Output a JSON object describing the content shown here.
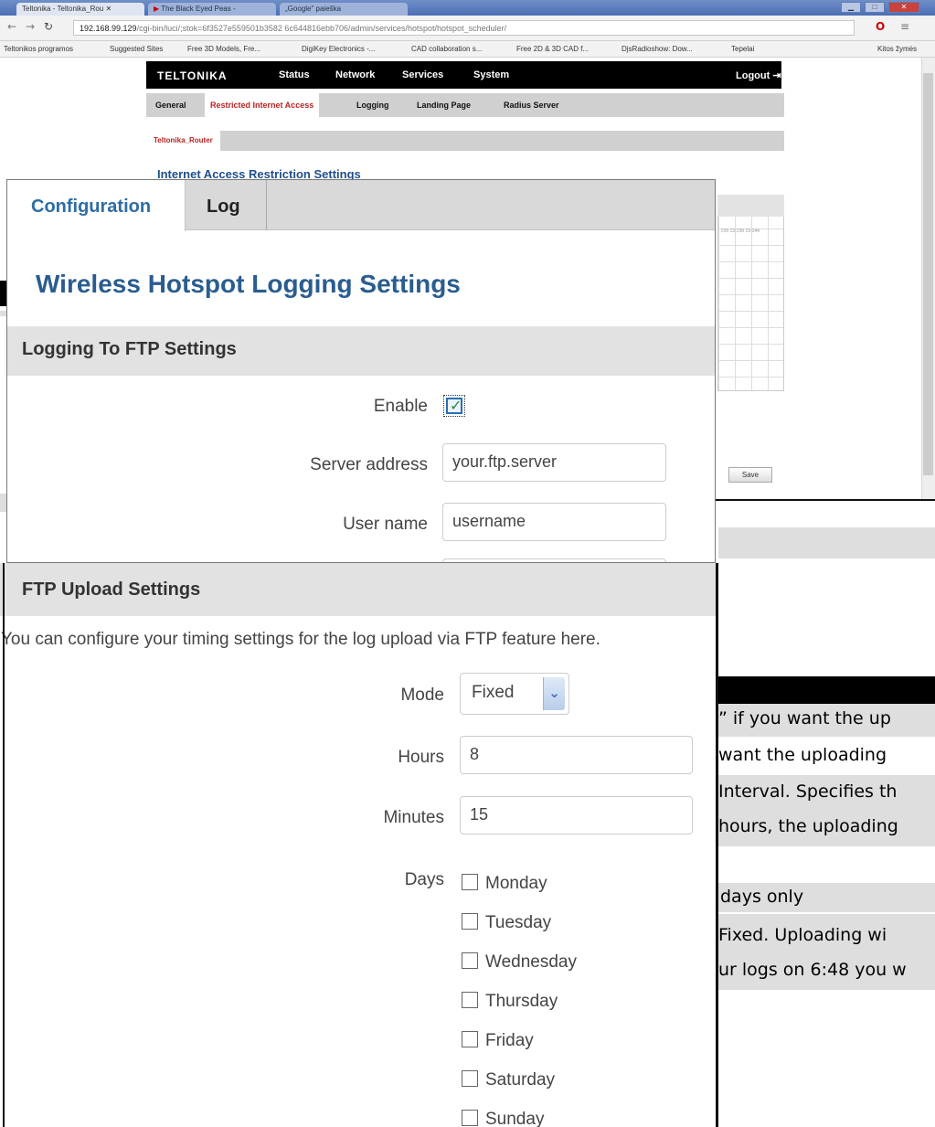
{
  "browser": {
    "tabs": [
      "Teltonika - Teltonika_Rou",
      "The Black Eyed Peas -",
      "„Google\" paieška"
    ],
    "url_host": "192.168.99.129",
    "url_path": "/cgi-bin/luci/;stok=6f3527e559501b3582 6c644816ebb706/admin/services/hotspot/hotspot_scheduler/",
    "bookmarks": [
      "Teltonikos programos",
      "Suggested Sites",
      "Free 3D Models, Fre...",
      "DigiKey Electronics -...",
      "CAD collaboration s...",
      "Free 2D & 3D CAD f...",
      "DjsRadioshow: Dow...",
      "Tepelai",
      "Kitos žymės"
    ]
  },
  "teltonika": {
    "logo": "TELTONIKA",
    "nav": [
      "Status",
      "Network",
      "Services",
      "System"
    ],
    "logout": "Logout",
    "tabs": [
      "General",
      "Restricted Internet Access",
      "Logging",
      "Landing Page",
      "Radius Server"
    ],
    "subtab": "Teltonika_Router",
    "heading": "Internet Access Restriction Settings",
    "hours_row": "22h 22-23h 23-24h",
    "save": "Save"
  },
  "document": {
    "frag1": "” if you want the up",
    "frag2": "want the uploading",
    "frag3": "Interval. Specifies th",
    "frag4": "hours, the uploading",
    "frag5": "days only",
    "frag6": "Fixed. Uploading wi",
    "frag7": "ur logs on 6:48 you w"
  },
  "logging_panel": {
    "tabs": {
      "active": "Configuration",
      "other": "Log"
    },
    "title": "Wireless Hotspot Logging Settings",
    "section": "Logging To FTP Settings",
    "enable_label": "Enable",
    "enable_checked": true,
    "server_label": "Server address",
    "server_value": "your.ftp.server",
    "user_label": "User name",
    "user_value": "username"
  },
  "upload_panel": {
    "section": "FTP Upload Settings",
    "description": "You can configure your timing settings for the log upload via FTP feature here.",
    "mode_label": "Mode",
    "mode_value": "Fixed",
    "hours_label": "Hours",
    "hours_value": "8",
    "minutes_label": "Minutes",
    "minutes_value": "15",
    "days_label": "Days",
    "days": [
      "Monday",
      "Tuesday",
      "Wednesday",
      "Thursday",
      "Friday",
      "Saturday",
      "Sunday"
    ]
  },
  "colors": {
    "link_blue": "#2e6da4",
    "title_blue": "#2a5d8f",
    "teltonika_red": "#bb2222",
    "check_green": "#2f8a2f"
  }
}
